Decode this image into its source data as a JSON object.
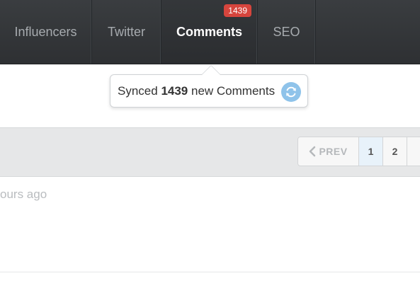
{
  "nav": {
    "tabs": [
      {
        "label": "Influencers"
      },
      {
        "label": "Twitter"
      },
      {
        "label": "Comments",
        "badge": "1439"
      },
      {
        "label": "SEO"
      }
    ]
  },
  "popover": {
    "prefix": "Synced ",
    "count": "1439",
    "suffix": " new Comments",
    "icon": "refresh-icon"
  },
  "pagination": {
    "prev_label": "PREV",
    "pages": [
      "1",
      "2"
    ],
    "active_page": "1"
  },
  "list": {
    "time_text": "ours ago"
  },
  "colors": {
    "nav_bg": "#2e3033",
    "badge": "#d6453d",
    "sync_icon": "#8fc3ea",
    "active_page_bg": "#e8f2fa",
    "toolbar_bg": "#e6e7e8"
  }
}
